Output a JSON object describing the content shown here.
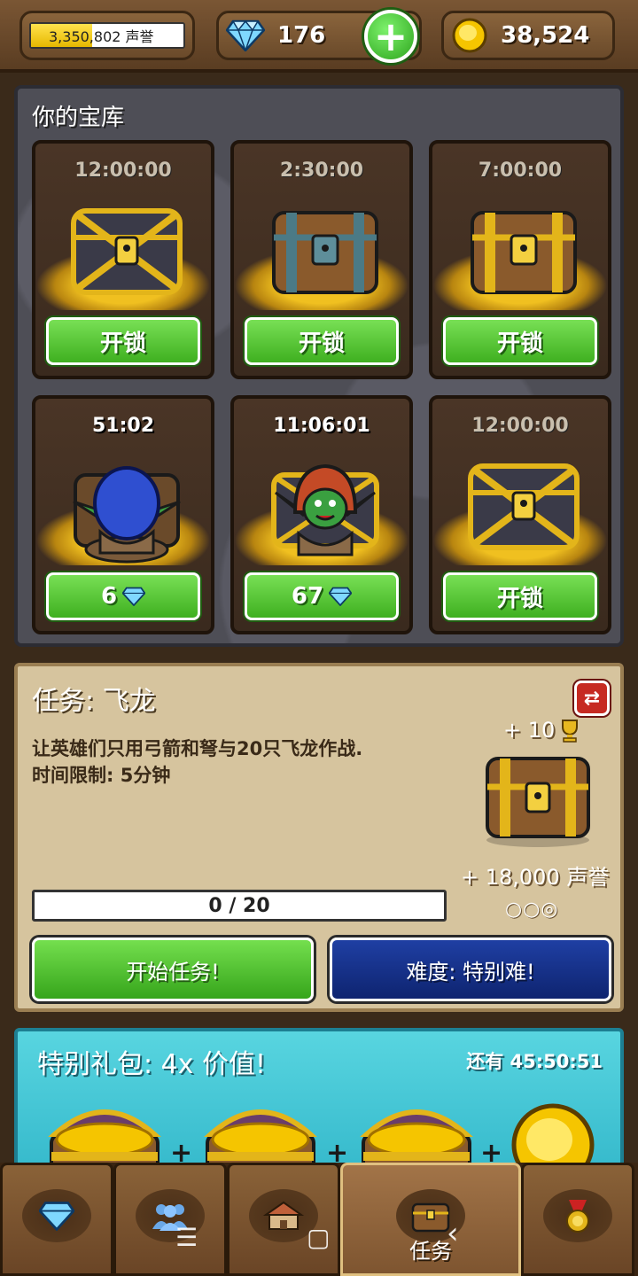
{
  "topbar": {
    "reputation_text": "3,350,802 声誉",
    "reputation_progress": 0.4,
    "gems": "176",
    "add_gems_label": "+",
    "gold": "38,524"
  },
  "treasury": {
    "title": "你的宝库",
    "slots": [
      {
        "time": "12:00:00",
        "button": "开锁",
        "chest": "iron-cross-chest",
        "active": false
      },
      {
        "time": "2:30:00",
        "button": "开锁",
        "chest": "wooden-steel-chest",
        "active": false
      },
      {
        "time": "7:00:00",
        "button": "开锁",
        "chest": "wooden-gold-chest",
        "active": false
      },
      {
        "time": "51:02",
        "button": "6",
        "chest": "goblin-blue-chest",
        "active": true
      },
      {
        "time": "11:06:01",
        "button": "67",
        "chest": "goblin-red-chest",
        "active": true
      },
      {
        "time": "12:00:00",
        "button": "开锁",
        "chest": "gold-cross-chest",
        "active": false
      }
    ]
  },
  "quest": {
    "title": "任务: 飞龙",
    "description_line1": "让英雄们只用弓箭和弩与20只飞龙作战.",
    "description_line2": "时间限制: 5分钟",
    "reward_trophies": "+ 10",
    "reward_reputation": "+ 18,000 声誉",
    "difficulty_pips": "○○◎",
    "progress": "0 / 20",
    "start_button": "开始任务!",
    "difficulty_button": "难度: 特别难!"
  },
  "pack": {
    "title": "特别礼包: 4x 价值!",
    "timer": "还有 45:50:51",
    "plus": "+"
  },
  "nav": {
    "tabs": [
      {
        "icon": "gem-icon",
        "label": ""
      },
      {
        "icon": "heroes-icon",
        "label": ""
      },
      {
        "icon": "village-icon",
        "label": ""
      },
      {
        "icon": "chest-icon",
        "label": "任务"
      },
      {
        "icon": "medal-icon",
        "label": ""
      }
    ],
    "system": {
      "menu": "☰",
      "home": "▢",
      "back": "‹"
    }
  },
  "colors": {
    "button_green": "#4cc02a",
    "button_blue": "#142f8a",
    "parchment": "#d6c49e",
    "pack_cyan": "#3fc3d3"
  }
}
